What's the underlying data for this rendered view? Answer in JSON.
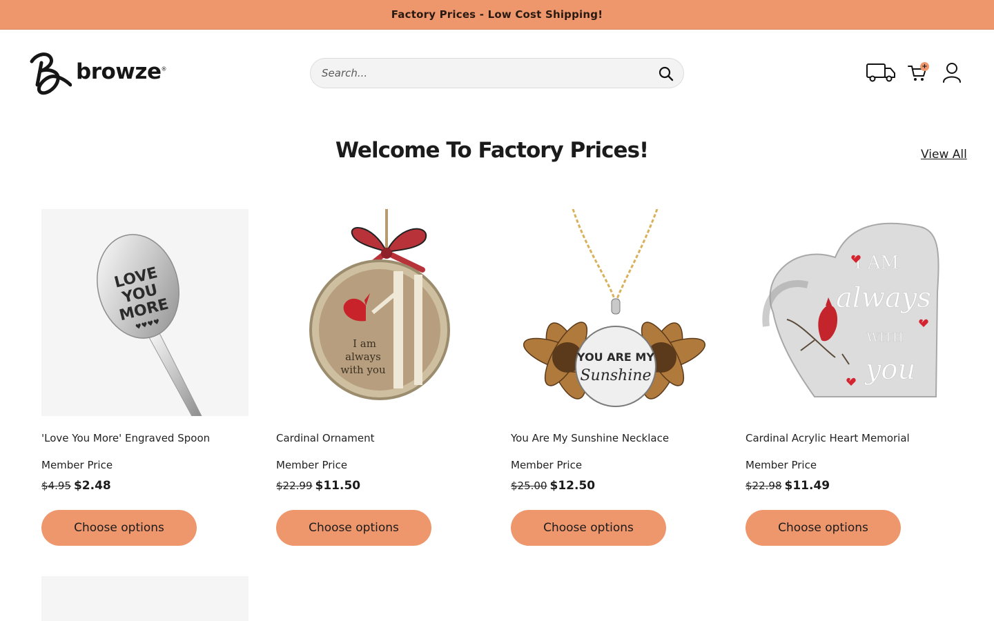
{
  "announcement": "Factory Prices - Low Cost Shipping!",
  "brand": {
    "name": "browze",
    "mark": "®"
  },
  "search": {
    "placeholder": "Search..."
  },
  "header_icons": [
    "truck-icon",
    "cart-icon",
    "account-icon"
  ],
  "cart": {
    "count": "+"
  },
  "section": {
    "title": "Welcome To Factory Prices!",
    "view_all": "View All"
  },
  "colors": {
    "accent": "#ef976c",
    "text": "#1b1b1b",
    "image_bg": "#f5f5f5"
  },
  "products": [
    {
      "name": "'Love You More' Engraved Spoon",
      "member_label": "Member Price",
      "old_price": "$4.95",
      "price": "$2.48",
      "button": "Choose options",
      "image_text": [
        "LOVE",
        "YOU",
        "MORE"
      ]
    },
    {
      "name": "Cardinal Ornament",
      "member_label": "Member Price",
      "old_price": "$22.99",
      "price": "$11.50",
      "button": "Choose options",
      "image_text": [
        "I am",
        "always",
        "with you"
      ]
    },
    {
      "name": "You Are My Sunshine Necklace",
      "member_label": "Member Price",
      "old_price": "$25.00",
      "price": "$12.50",
      "button": "Choose options",
      "image_text": [
        "YOU ARE MY",
        "Sunshine"
      ]
    },
    {
      "name": "Cardinal Acrylic Heart Memorial",
      "member_label": "Member Price",
      "old_price": "$22.98",
      "price": "$11.49",
      "button": "Choose options",
      "image_text": [
        "I AM",
        "always",
        "WITH",
        "you"
      ]
    }
  ]
}
